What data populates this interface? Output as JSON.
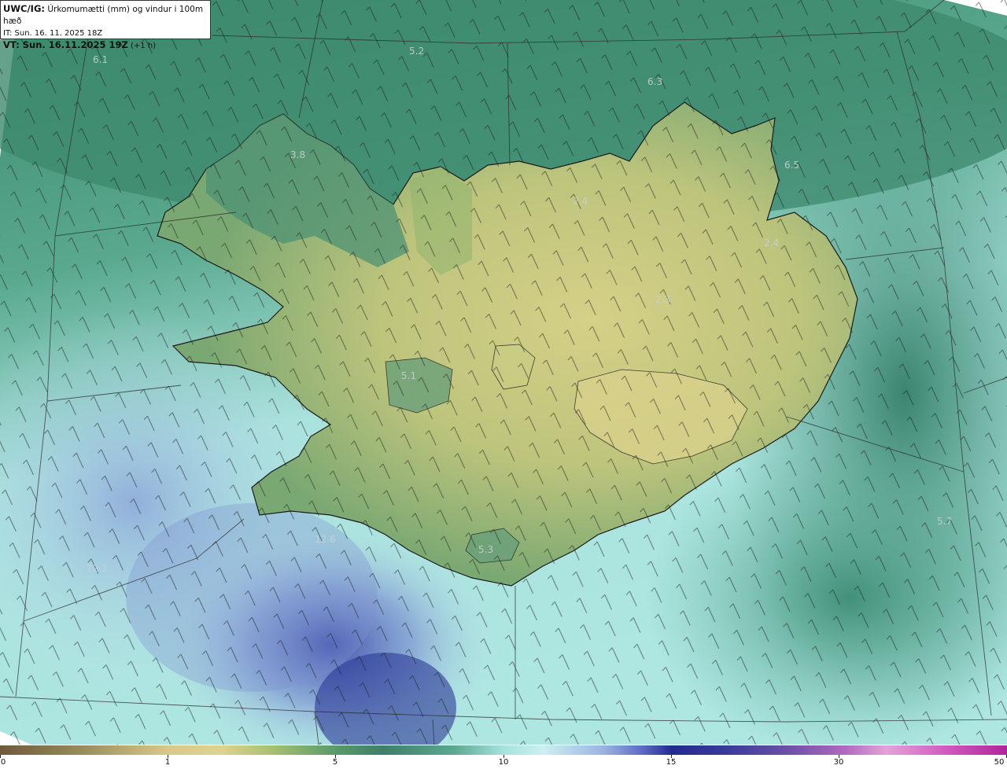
{
  "header": {
    "title_bold": "UWC/IG:",
    "title_rest": " Úrkomumætti (mm) og vindur i 100m hæð",
    "it_line": "IT: Sun. 16. 11. 2025 18Z",
    "vt_bold": "VT: Sun. 16.11.2025 19Z",
    "vt_rest": " (+1 h)"
  },
  "colors": {
    "land_low": "#9fb86e",
    "land_high": "#d4cf86",
    "sea_green": "#3f8b6f",
    "sea_light": "#a9e4dc",
    "sea_blue": "#6f85c8",
    "sea_dark": "#2d3a9a",
    "coastline": "#1a1a1a"
  },
  "value_labels": [
    {
      "text": "6.1"
    },
    {
      "text": "5.2"
    },
    {
      "text": "6.3"
    },
    {
      "text": "6.5"
    },
    {
      "text": "3.8"
    },
    {
      "text": "2.4"
    },
    {
      "text": "2.4"
    },
    {
      "text": "2.3"
    },
    {
      "text": "5.1"
    },
    {
      "text": "5.3"
    },
    {
      "text": "5.7"
    },
    {
      "text": "12.6"
    },
    {
      "text": "12.1"
    }
  ],
  "colorbar": {
    "ticks": [
      "0",
      "1",
      "5",
      "10",
      "15",
      "30",
      "50"
    ]
  }
}
